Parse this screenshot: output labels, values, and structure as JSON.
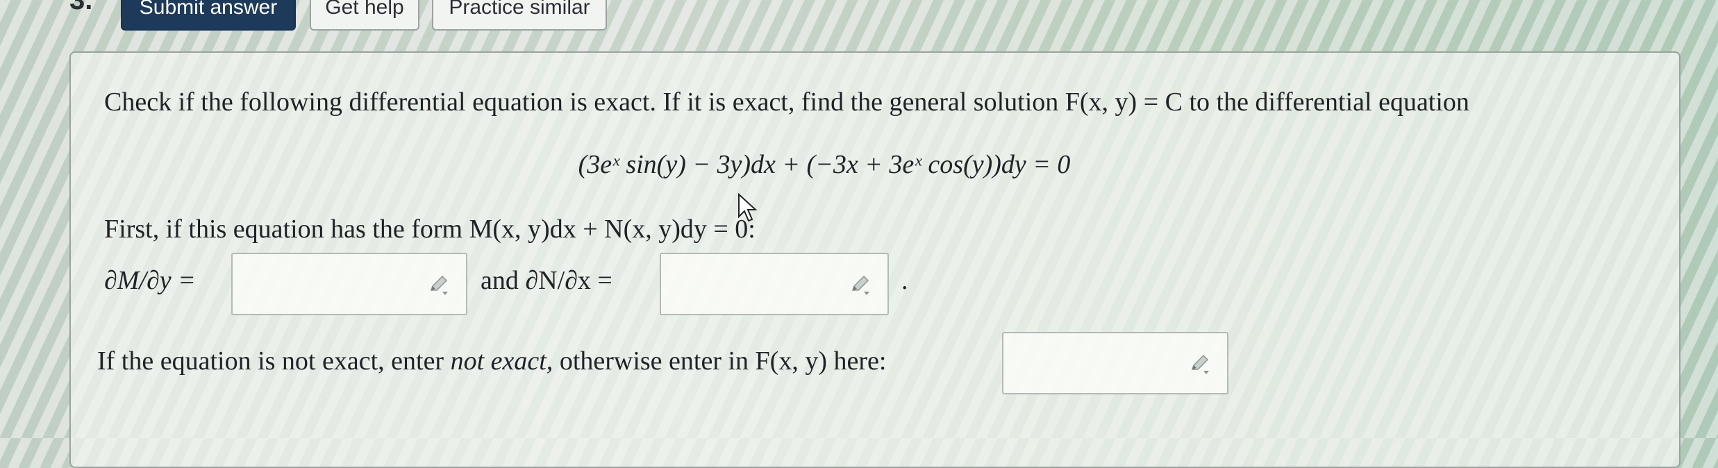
{
  "header": {
    "question_number": "3.",
    "submit_label": "Submit answer",
    "help_label": "Get help",
    "similar_label": "Practice similar"
  },
  "problem": {
    "prompt": "Check if the following differential equation is exact. If it is exact, find the general solution F(x, y) = C to the differential equation",
    "equation": "(3eˣ sin(y) − 3y)dx + (−3x + 3eˣ cos(y))dy = 0",
    "form_text": "First, if this equation has the form M(x, y)dx + N(x, y)dy = 0:",
    "dM_label": "∂M/∂y =",
    "and_dN_label": "and ∂N/∂x =",
    "period": ".",
    "final_text_pre": "If the equation is not exact, enter ",
    "final_text_em": "not exact,",
    "final_text_post": " otherwise enter in F(x, y) here:"
  },
  "inputs": {
    "dM_value": "",
    "dN_value": "",
    "F_value": ""
  },
  "icons": {
    "edit": "pencil-icon",
    "cursor": "mouse-pointer-icon"
  },
  "colors": {
    "primary_button": "#1e3a5a",
    "text": "#1f2226"
  }
}
